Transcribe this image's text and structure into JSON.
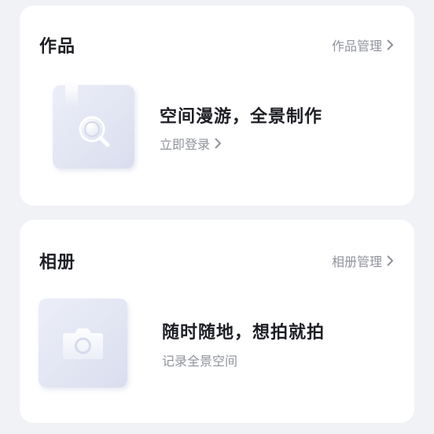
{
  "works": {
    "title": "作品",
    "manage_label": "作品管理",
    "headline": "空间漫游，全景制作",
    "action_label": "立即登录",
    "thumb_icon": "bookmark-search-icon"
  },
  "album": {
    "title": "相册",
    "manage_label": "相册管理",
    "headline": "随时随地，想拍就拍",
    "subline": "记录全景空间",
    "thumb_icon": "camera-icon"
  },
  "colors": {
    "background": "#f1f2f6",
    "card": "#ffffff",
    "primary_text": "#1d1f24",
    "secondary_text": "#8f939b"
  }
}
